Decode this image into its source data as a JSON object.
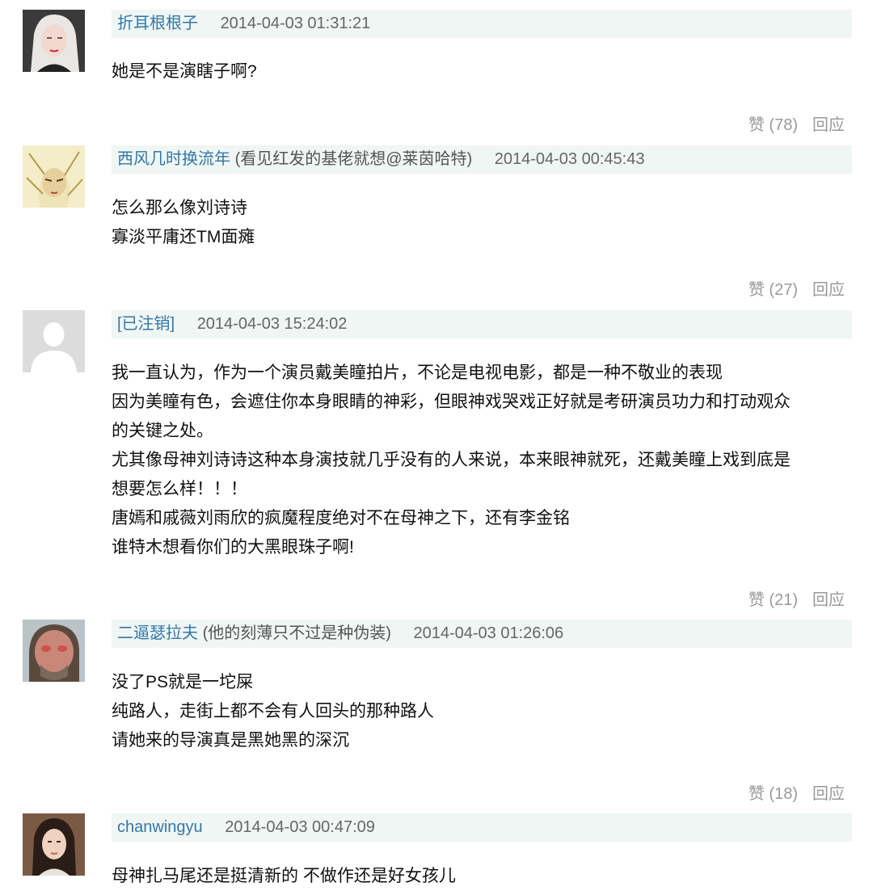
{
  "comments": [
    {
      "author": "折耳根根子",
      "signature": "",
      "time": "2014-04-03 01:31:21",
      "lines": [
        "她是不是演瞎子啊?"
      ],
      "likes": "赞 (78)",
      "reply": "回应"
    },
    {
      "author": "西风几时换流年",
      "signature": "(看见红发的基佬就想@莱茵哈特)",
      "time": "2014-04-03 00:45:43",
      "lines": [
        "怎么那么像刘诗诗",
        "寡淡平庸还TM面瘫"
      ],
      "likes": "赞 (27)",
      "reply": "回应"
    },
    {
      "author": "[已注销]",
      "signature": "",
      "time": "2014-04-03 15:24:02",
      "lines": [
        "我一直认为，作为一个演员戴美瞳拍片，不论是电视电影，都是一种不敬业的表现",
        "因为美瞳有色，会遮住你本身眼睛的神彩，但眼神戏哭戏正好就是考研演员功力和打动观众",
        "的关键之处。",
        "尤其像母神刘诗诗这种本身演技就几乎没有的人来说，本来眼神就死，还戴美瞳上戏到底是",
        "想要怎么样！！！",
        "唐嫣和戚薇刘雨欣的疯魔程度绝对不在母神之下，还有李金铭",
        "谁特木想看你们的大黑眼珠子啊!"
      ],
      "likes": "赞 (21)",
      "reply": "回应"
    },
    {
      "author": "二逼瑟拉夫",
      "signature": "(他的刻薄只不过是种伪装)",
      "time": "2014-04-03 01:26:06",
      "lines": [
        "没了PS就是一坨屎",
        "纯路人，走街上都不会有人回头的那种路人",
        "请她来的导演真是黑她黑的深沉"
      ],
      "likes": "赞 (18)",
      "reply": "回应"
    },
    {
      "author": "chanwingyu",
      "signature": "",
      "time": "2014-04-03 00:47:09",
      "lines": [
        "母神扎马尾还是挺清新的 不做作还是好女孩儿"
      ],
      "likes": "",
      "reply": ""
    }
  ]
}
